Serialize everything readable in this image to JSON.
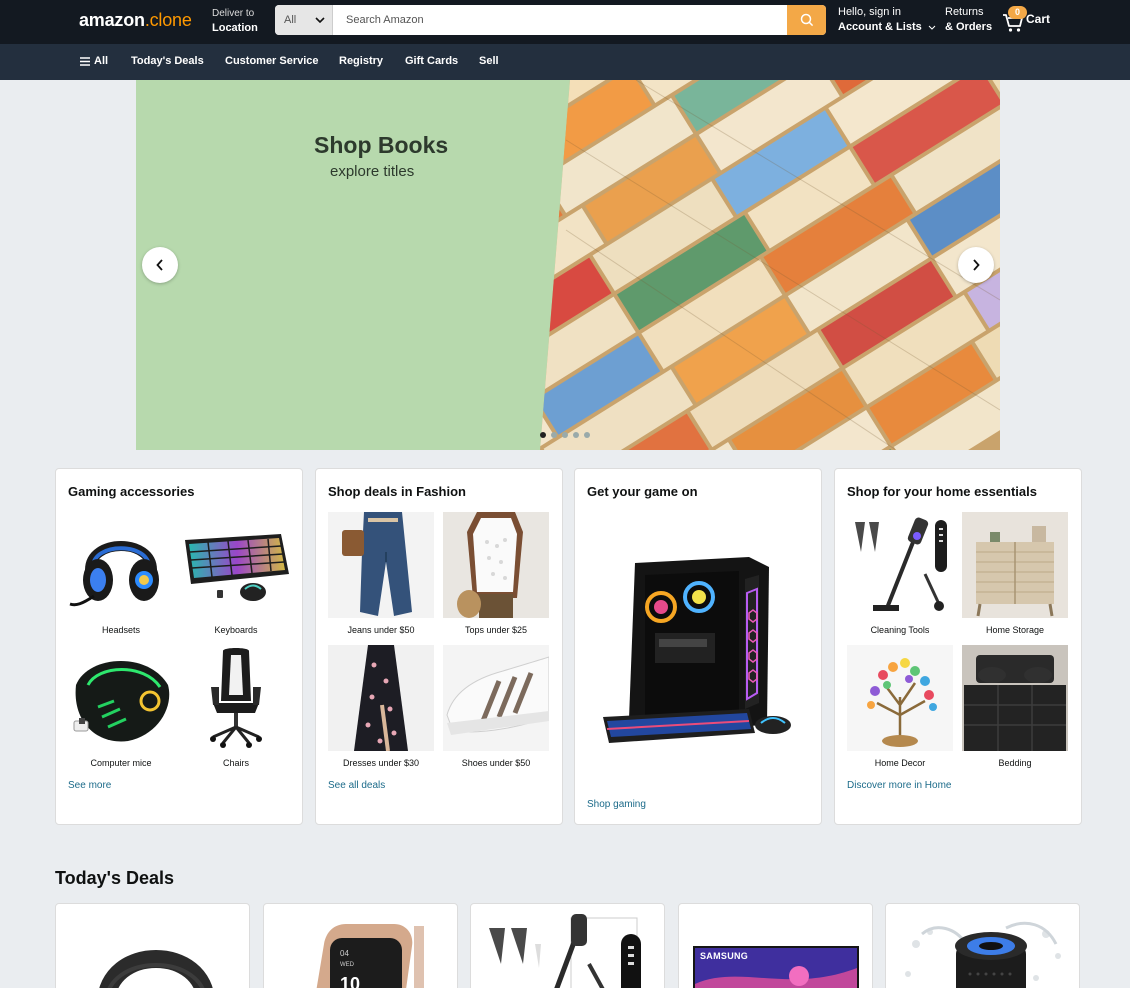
{
  "header": {
    "logo_main": "amazon",
    "logo_suffix": ".clone",
    "deliver_line1": "Deliver to",
    "deliver_line2": "Location",
    "search": {
      "category": "All",
      "placeholder": "Search Amazon"
    },
    "account_line1": "Hello, sign in",
    "account_line2": "Account & Lists",
    "returns_line1": "Returns",
    "returns_line2": "& Orders",
    "cart_count": "0",
    "cart_label": "Cart"
  },
  "nav": {
    "all_label": "All",
    "items": [
      "Today's Deals",
      "Customer Service",
      "Registry",
      "Gift Cards",
      "Sell"
    ]
  },
  "hero": {
    "title": "Shop Books",
    "subtitle": "explore titles",
    "slide_count": 5,
    "active_slide": 1
  },
  "cards": [
    {
      "title": "Gaming accessories",
      "tiles": [
        {
          "label": "Headsets",
          "icon": "headset-image"
        },
        {
          "label": "Keyboards",
          "icon": "keyboard-image"
        },
        {
          "label": "Computer mice",
          "icon": "mouse-image"
        },
        {
          "label": "Chairs",
          "icon": "chair-image"
        }
      ],
      "link": "See more"
    },
    {
      "title": "Shop deals in Fashion",
      "tiles": [
        {
          "label": "Jeans under $50",
          "icon": "jeans-image"
        },
        {
          "label": "Tops under $25",
          "icon": "top-image"
        },
        {
          "label": "Dresses under $30",
          "icon": "dress-image"
        },
        {
          "label": "Shoes under $50",
          "icon": "shoe-image"
        }
      ],
      "link": "See all deals"
    },
    {
      "title": "Get your game on",
      "link": "Shop gaming"
    },
    {
      "title": "Shop for your home essentials",
      "tiles": [
        {
          "label": "Cleaning Tools",
          "icon": "vacuum-image"
        },
        {
          "label": "Home Storage",
          "icon": "cabinet-image"
        },
        {
          "label": "Home Decor",
          "icon": "crystal-tree-image"
        },
        {
          "label": "Bedding",
          "icon": "comforter-image"
        }
      ],
      "link": "Discover more in Home"
    }
  ],
  "deals": {
    "title": "Today's Deals",
    "items": [
      {
        "icon": "headphones-image"
      },
      {
        "icon": "smartwatch-image"
      },
      {
        "icon": "vacuum-image"
      },
      {
        "icon": "tv-image",
        "brand": "SAMSUNG"
      },
      {
        "icon": "speaker-image"
      }
    ]
  }
}
